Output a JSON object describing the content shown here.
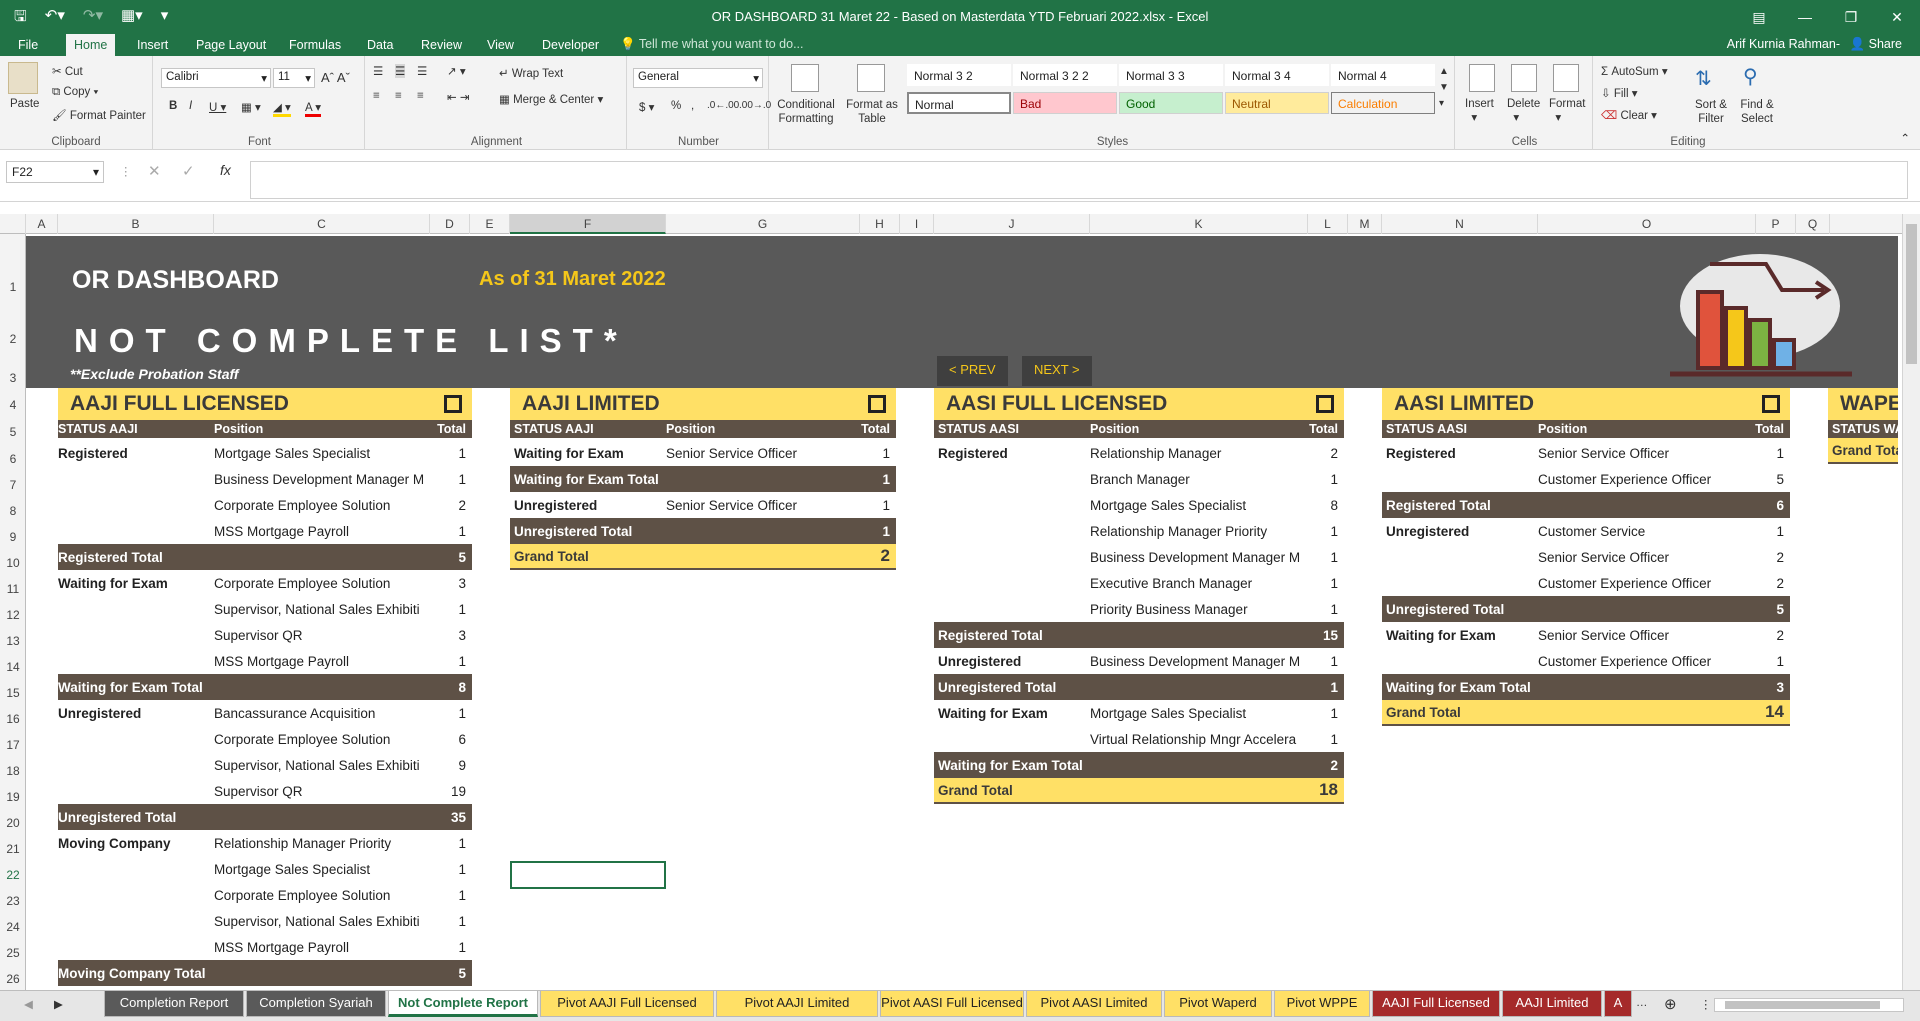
{
  "title": "OR DASHBOARD 31 Maret 22 - Based on Masterdata YTD Februari 2022.xlsx - Excel",
  "tabs": [
    "File",
    "Home",
    "Insert",
    "Page Layout",
    "Formulas",
    "Data",
    "Review",
    "View",
    "Developer"
  ],
  "tell_me": "Tell me what you want to do...",
  "user": "Arif Kurnia Rahman-",
  "share": "Share",
  "ribbon": {
    "clipboard": {
      "label": "Clipboard",
      "paste": "Paste",
      "cut": "Cut",
      "copy": "Copy",
      "painter": "Format Painter"
    },
    "font": {
      "label": "Font",
      "name": "Calibri",
      "size": "11"
    },
    "alignment": {
      "label": "Alignment",
      "wrap": "Wrap Text",
      "merge": "Merge & Center"
    },
    "number": {
      "label": "Number",
      "format": "General"
    },
    "styles": {
      "label": "Styles",
      "cond": "Conditional Formatting",
      "fat": "Format as Table",
      "cells": [
        "Normal 3 2",
        "Normal 3 2 2",
        "Normal 3 3",
        "Normal 3 4",
        "Normal 4",
        "Normal",
        "Bad",
        "Good",
        "Neutral",
        "Calculation"
      ]
    },
    "cells": {
      "label": "Cells",
      "insert": "Insert",
      "delete": "Delete",
      "format": "Format"
    },
    "editing": {
      "label": "Editing",
      "autosum": "AutoSum",
      "fill": "Fill",
      "clear": "Clear",
      "sort": "Sort & Filter",
      "find": "Find & Select"
    }
  },
  "name_box": "F22",
  "columns": [
    "A",
    "B",
    "C",
    "D",
    "E",
    "F",
    "G",
    "H",
    "I",
    "J",
    "K",
    "L",
    "M",
    "N",
    "O",
    "P",
    "Q"
  ],
  "rows": [
    "1",
    "2",
    "3",
    "4",
    "5",
    "6",
    "7",
    "8",
    "9",
    "10",
    "11",
    "12",
    "13",
    "14",
    "15",
    "16",
    "17",
    "18",
    "19",
    "20",
    "21",
    "22",
    "23",
    "24",
    "25",
    "26"
  ],
  "banner": {
    "title": "OR DASHBOARD",
    "date": "As of 31 Maret 2022",
    "main": "NOT COMPLETE LIST*",
    "note": "**Exclude Probation Staff",
    "prev": "< PREV",
    "next": "NEXT >"
  },
  "panels": [
    {
      "title": "AAJI FULL LICENSED",
      "hdr": [
        "STATUS AAJI",
        "Position",
        "Total"
      ],
      "rows": [
        [
          "d",
          "Registered",
          "Mortgage Sales Specialist",
          "1"
        ],
        [
          "d",
          "",
          "Business Development Manager M",
          "1"
        ],
        [
          "d",
          "",
          "Corporate Employee Solution",
          "2"
        ],
        [
          "d",
          "",
          "MSS Mortgage Payroll",
          "1"
        ],
        [
          "t",
          "Registered Total",
          "",
          "5"
        ],
        [
          "d",
          "Waiting for Exam",
          "Corporate Employee Solution",
          "3"
        ],
        [
          "d",
          "",
          "Supervisor, National Sales Exhibiti",
          "1"
        ],
        [
          "d",
          "",
          "Supervisor QR",
          "3"
        ],
        [
          "d",
          "",
          "MSS Mortgage Payroll",
          "1"
        ],
        [
          "t",
          "Waiting for Exam Total",
          "",
          "8"
        ],
        [
          "d",
          "Unregistered",
          "Bancassurance Acquisition",
          "1"
        ],
        [
          "d",
          "",
          "Corporate Employee Solution",
          "6"
        ],
        [
          "d",
          "",
          "Supervisor, National Sales Exhibiti",
          "9"
        ],
        [
          "d",
          "",
          "Supervisor QR",
          "19"
        ],
        [
          "t",
          "Unregistered Total",
          "",
          "35"
        ],
        [
          "d",
          "Moving Company",
          "Relationship Manager Priority",
          "1"
        ],
        [
          "d",
          "",
          "Mortgage Sales Specialist",
          "1"
        ],
        [
          "d",
          "",
          "Corporate Employee Solution",
          "1"
        ],
        [
          "d",
          "",
          "Supervisor, National Sales Exhibiti",
          "1"
        ],
        [
          "d",
          "",
          "MSS Mortgage Payroll",
          "1"
        ],
        [
          "t",
          "Moving Company Total",
          "",
          "5"
        ]
      ]
    },
    {
      "title": "AAJI LIMITED",
      "hdr": [
        "STATUS AAJI",
        "Position",
        "Total"
      ],
      "rows": [
        [
          "d",
          "Waiting for Exam",
          "Senior Service Officer",
          "1"
        ],
        [
          "t",
          "Waiting for Exam Total",
          "",
          "1"
        ],
        [
          "d",
          "Unregistered",
          "Senior Service Officer",
          "1"
        ],
        [
          "t",
          "Unregistered Total",
          "",
          "1"
        ],
        [
          "g",
          "Grand Total",
          "",
          "2"
        ]
      ]
    },
    {
      "title": "AASI FULL LICENSED",
      "hdr": [
        "STATUS AASI",
        "Position",
        "Total"
      ],
      "rows": [
        [
          "d",
          "Registered",
          "Relationship Manager",
          "2"
        ],
        [
          "d",
          "",
          "Branch Manager",
          "1"
        ],
        [
          "d",
          "",
          "Mortgage Sales Specialist",
          "8"
        ],
        [
          "d",
          "",
          "Relationship Manager Priority",
          "1"
        ],
        [
          "d",
          "",
          "Business Development Manager M",
          "1"
        ],
        [
          "d",
          "",
          "Executive Branch Manager",
          "1"
        ],
        [
          "d",
          "",
          "Priority Business Manager",
          "1"
        ],
        [
          "t",
          "Registered Total",
          "",
          "15"
        ],
        [
          "d",
          "Unregistered",
          "Business Development Manager M",
          "1"
        ],
        [
          "t",
          "Unregistered Total",
          "",
          "1"
        ],
        [
          "d",
          "Waiting for Exam",
          "Mortgage Sales Specialist",
          "1"
        ],
        [
          "d",
          "",
          "Virtual Relationship Mngr Accelera",
          "1"
        ],
        [
          "t",
          "Waiting for Exam Total",
          "",
          "2"
        ],
        [
          "g",
          "Grand Total",
          "",
          "18"
        ]
      ]
    },
    {
      "title": "AASI LIMITED",
      "hdr": [
        "STATUS AASI",
        "Position",
        "Total"
      ],
      "rows": [
        [
          "d",
          "Registered",
          "Senior Service Officer",
          "1"
        ],
        [
          "d",
          "",
          "Customer Experience Officer",
          "5"
        ],
        [
          "t",
          "Registered Total",
          "",
          "6"
        ],
        [
          "d",
          "Unregistered",
          "Customer Service",
          "1"
        ],
        [
          "d",
          "",
          "Senior Service Officer",
          "2"
        ],
        [
          "d",
          "",
          "Customer Experience Officer",
          "2"
        ],
        [
          "t",
          "Unregistered Total",
          "",
          "5"
        ],
        [
          "d",
          "Waiting for Exam",
          "Senior Service Officer",
          "2"
        ],
        [
          "d",
          "",
          "Customer Experience Officer",
          "1"
        ],
        [
          "t",
          "Waiting for Exam Total",
          "",
          "3"
        ],
        [
          "g",
          "Grand Total",
          "",
          "14"
        ]
      ]
    },
    {
      "title": "WAPE",
      "hdr": [
        "STATUS WA",
        "",
        ""
      ],
      "rows": [
        [
          "g",
          "Grand Tota",
          "",
          ""
        ]
      ]
    }
  ],
  "sheets": [
    "Completion Report",
    "Completion Syariah",
    "Not Complete Report",
    "Pivot AAJI Full Licensed",
    "Pivot AAJI Limited",
    "Pivot AASI Full Licensed",
    "Pivot AASI Limited",
    "Pivot Waperd",
    "Pivot WPPE",
    "AAJI Full Licensed",
    "AAJI Limited",
    "A"
  ]
}
